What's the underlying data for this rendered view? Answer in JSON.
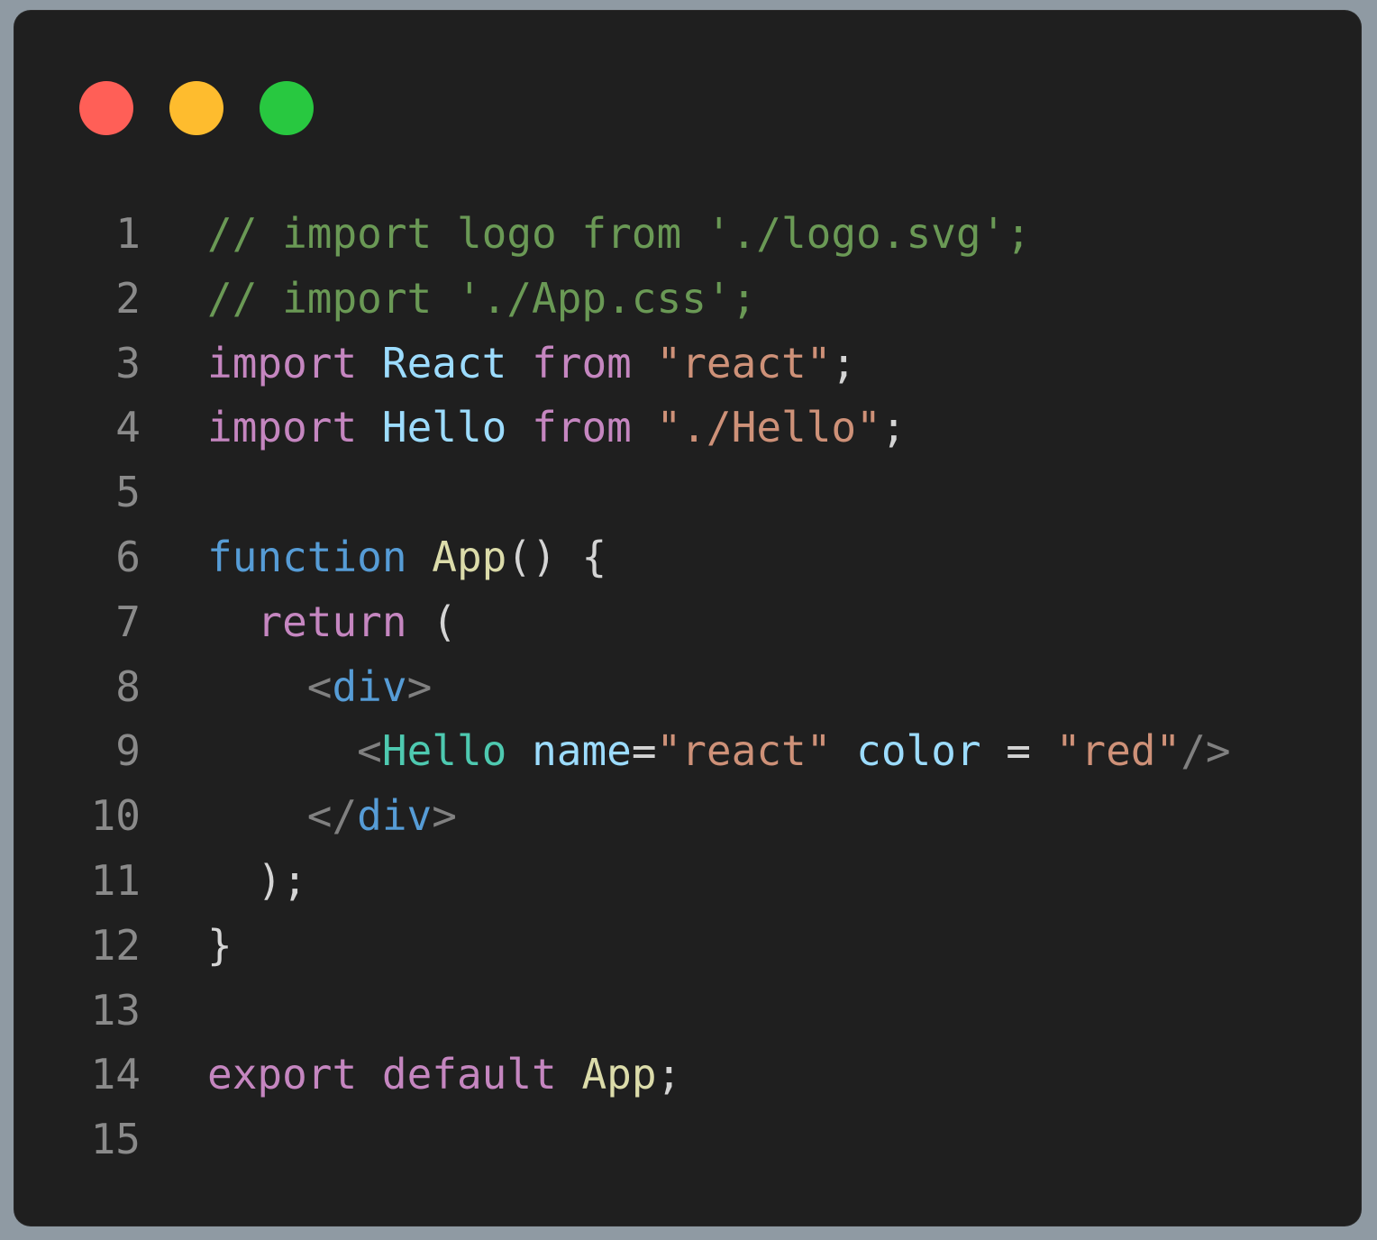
{
  "window": {
    "traffic_lights": [
      {
        "name": "close-dot",
        "color": "#ff5f57"
      },
      {
        "name": "minimize-dot",
        "color": "#febc2e"
      },
      {
        "name": "zoom-dot",
        "color": "#28c840"
      }
    ]
  },
  "editor": {
    "lines": [
      {
        "n": "1",
        "tokens": [
          {
            "t": "// import logo from './logo.svg';",
            "k": "comment"
          }
        ]
      },
      {
        "n": "2",
        "tokens": [
          {
            "t": "// import './App.css';",
            "k": "comment"
          }
        ]
      },
      {
        "n": "3",
        "tokens": [
          {
            "t": "import",
            "k": "keyword"
          },
          {
            "t": " ",
            "k": "punct"
          },
          {
            "t": "React",
            "k": "var"
          },
          {
            "t": " ",
            "k": "punct"
          },
          {
            "t": "from",
            "k": "keyword"
          },
          {
            "t": " ",
            "k": "punct"
          },
          {
            "t": "\"react\"",
            "k": "string"
          },
          {
            "t": ";",
            "k": "punct"
          }
        ]
      },
      {
        "n": "4",
        "tokens": [
          {
            "t": "import",
            "k": "keyword"
          },
          {
            "t": " ",
            "k": "punct"
          },
          {
            "t": "Hello",
            "k": "var"
          },
          {
            "t": " ",
            "k": "punct"
          },
          {
            "t": "from",
            "k": "keyword"
          },
          {
            "t": " ",
            "k": "punct"
          },
          {
            "t": "\"./Hello\"",
            "k": "string"
          },
          {
            "t": ";",
            "k": "punct"
          }
        ]
      },
      {
        "n": "5",
        "tokens": []
      },
      {
        "n": "6",
        "tokens": [
          {
            "t": "function",
            "k": "decl"
          },
          {
            "t": " ",
            "k": "punct"
          },
          {
            "t": "App",
            "k": "func"
          },
          {
            "t": "() {",
            "k": "punct"
          }
        ]
      },
      {
        "n": "7",
        "tokens": [
          {
            "t": "  ",
            "k": "punct"
          },
          {
            "t": "return",
            "k": "keyword"
          },
          {
            "t": " (",
            "k": "punct"
          }
        ]
      },
      {
        "n": "8",
        "tokens": [
          {
            "t": "    ",
            "k": "punct"
          },
          {
            "t": "<",
            "k": "tagbracket"
          },
          {
            "t": "div",
            "k": "tag"
          },
          {
            "t": ">",
            "k": "tagbracket"
          }
        ]
      },
      {
        "n": "9",
        "tokens": [
          {
            "t": "      ",
            "k": "punct"
          },
          {
            "t": "<",
            "k": "tagbracket"
          },
          {
            "t": "Hello",
            "k": "component"
          },
          {
            "t": " ",
            "k": "punct"
          },
          {
            "t": "name",
            "k": "attr"
          },
          {
            "t": "=",
            "k": "punct"
          },
          {
            "t": "\"react\"",
            "k": "string"
          },
          {
            "t": " ",
            "k": "punct"
          },
          {
            "t": "color",
            "k": "attr"
          },
          {
            "t": " = ",
            "k": "punct"
          },
          {
            "t": "\"red\"",
            "k": "string"
          },
          {
            "t": "/>",
            "k": "tagbracket"
          }
        ]
      },
      {
        "n": "10",
        "tokens": [
          {
            "t": "    ",
            "k": "punct"
          },
          {
            "t": "</",
            "k": "tagbracket"
          },
          {
            "t": "div",
            "k": "tag"
          },
          {
            "t": ">",
            "k": "tagbracket"
          }
        ]
      },
      {
        "n": "11",
        "tokens": [
          {
            "t": "  );",
            "k": "punct"
          }
        ]
      },
      {
        "n": "12",
        "tokens": [
          {
            "t": "}",
            "k": "punct"
          }
        ]
      },
      {
        "n": "13",
        "tokens": []
      },
      {
        "n": "14",
        "tokens": [
          {
            "t": "export",
            "k": "keyword"
          },
          {
            "t": " ",
            "k": "punct"
          },
          {
            "t": "default",
            "k": "keyword"
          },
          {
            "t": " ",
            "k": "punct"
          },
          {
            "t": "App",
            "k": "func"
          },
          {
            "t": ";",
            "k": "punct"
          }
        ]
      },
      {
        "n": "15",
        "tokens": []
      }
    ]
  }
}
